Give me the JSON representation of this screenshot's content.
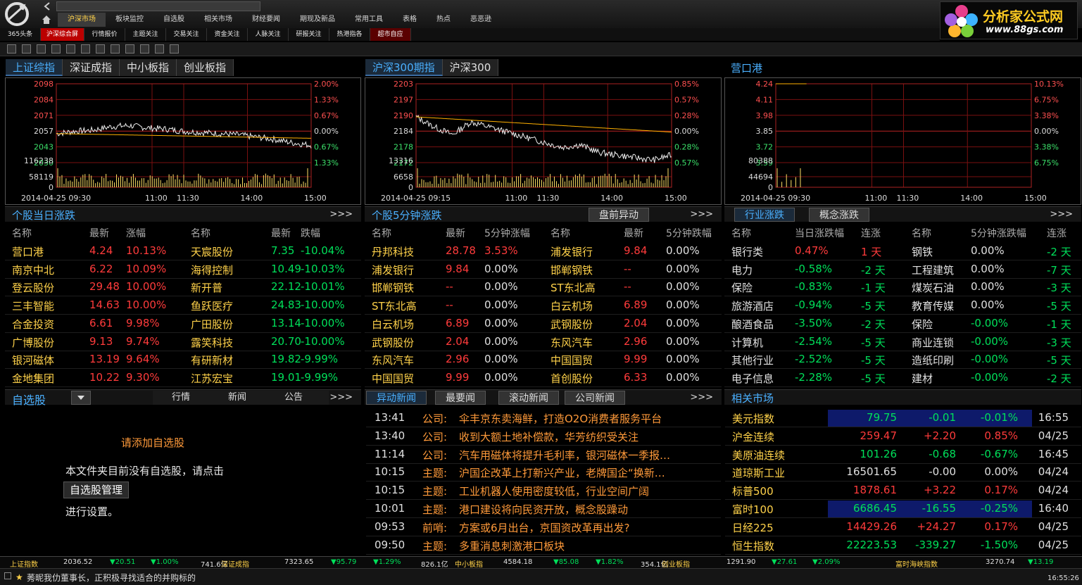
{
  "nav1": [
    "沪深市场",
    "板块监控",
    "自选股",
    "相关市场",
    "财经要闻",
    "期现及新品",
    "常用工具",
    "表格",
    "热点",
    "恶恶逊"
  ],
  "nav2": [
    "365头条",
    "沪深综合屏",
    "行情报价",
    "主题关注",
    "交易关注",
    "资金关注",
    "人脉关注",
    "研报关注",
    "热港指各",
    "超市自应"
  ],
  "brand": {
    "title": "分析家公式网",
    "url": "www.88gs.com"
  },
  "panel1": {
    "tabs": [
      "上证综指",
      "深证成指",
      "中小板指",
      "创业板指"
    ],
    "y_left": [
      "2098",
      "2084",
      "2071",
      "2057",
      "2043",
      "2030"
    ],
    "y_right": [
      "2.00%",
      "1.33%",
      "0.67%",
      "0.00%",
      "0.67%",
      "1.33%"
    ],
    "vol": [
      "116238",
      "58119",
      "0"
    ],
    "date": "2014-04-25 09:30",
    "times": [
      "11:00",
      "11:30",
      "14:00",
      "15:00"
    ]
  },
  "panel2": {
    "tabs": [
      "沪深300期指",
      "沪深300"
    ],
    "y_left": [
      "2203",
      "2197",
      "2190",
      "2184",
      "2178",
      "2172"
    ],
    "y_right": [
      "0.85%",
      "0.57%",
      "0.28%",
      "0.00%",
      "0.28%",
      "0.57%"
    ],
    "vol": [
      "13316",
      "6658",
      "0"
    ],
    "date": "2014-04-25 09:15",
    "times": [
      "11:00",
      "11:30",
      "14:00",
      "15:00"
    ]
  },
  "panel3": {
    "title": "营口港",
    "y_left": [
      "4.24",
      "4.11",
      "3.98",
      "3.85",
      "3.72",
      "3.59"
    ],
    "y_right": [
      "10.13%",
      "6.75%",
      "3.38%",
      "0.00%",
      "3.38%",
      "6.75%"
    ],
    "vol": [
      "80388",
      "44694",
      "0"
    ],
    "date": "2014-04-25 09:30",
    "times": [
      "11:00",
      "11:30",
      "14:00",
      "15:00"
    ]
  },
  "chart_data": [
    {
      "type": "line",
      "title": "上证综指",
      "ylim": [
        2030,
        2098
      ],
      "x": [
        "09:30",
        "11:30/13:00",
        "15:00"
      ],
      "series": [
        {
          "values": [
            2055,
            2057,
            2058,
            2061,
            2062,
            2060,
            2059,
            2057,
            2056,
            2055,
            2054,
            2052,
            2050,
            2047,
            2045
          ]
        }
      ]
    },
    {
      "type": "line",
      "title": "沪深300期指",
      "ylim": [
        2172,
        2203
      ],
      "x": [
        "09:15",
        "11:30/13:00",
        "15:15"
      ],
      "series": [
        {
          "values": [
            2190,
            2186,
            2183,
            2188,
            2186,
            2184,
            2182,
            2180,
            2178,
            2179,
            2176,
            2175,
            2174,
            2173,
            2175
          ]
        }
      ]
    },
    {
      "type": "line",
      "title": "营口港",
      "ylim": [
        3.59,
        4.24
      ],
      "x": [
        "09:30",
        "15:00"
      ],
      "series": [
        {
          "values": [
            4.24,
            4.24,
            4.24,
            4.24,
            4.24,
            4.24,
            4.24,
            4.24
          ]
        }
      ]
    }
  ],
  "sec1": {
    "title": "个股当日涨跌",
    "more": ">>>",
    "hdr": [
      "名称",
      "最新",
      "涨幅",
      "名称",
      "最新",
      "跌幅"
    ],
    "up": [
      [
        "营口港",
        "4.24",
        "10.13%"
      ],
      [
        "南京中北",
        "6.22",
        "10.09%"
      ],
      [
        "登云股份",
        "29.48",
        "10.00%"
      ],
      [
        "三丰智能",
        "14.63",
        "10.00%"
      ],
      [
        "合金投资",
        "6.61",
        "9.98%"
      ],
      [
        "广博股份",
        "9.13",
        "9.74%"
      ],
      [
        "银河磁体",
        "13.19",
        "9.64%"
      ],
      [
        "金地集团",
        "10.22",
        "9.30%"
      ]
    ],
    "down": [
      [
        "天宸股份",
        "7.35",
        "-10.04%"
      ],
      [
        "海得控制",
        "10.49",
        "-10.03%"
      ],
      [
        "新开普",
        "22.12",
        "-10.01%"
      ],
      [
        "鱼跃医疗",
        "24.83",
        "-10.00%"
      ],
      [
        "广田股份",
        "13.14",
        "-10.00%"
      ],
      [
        "露笑科技",
        "20.70",
        "-10.00%"
      ],
      [
        "有研新材",
        "19.82",
        "-9.99%"
      ],
      [
        "江苏宏宝",
        "19.01",
        "-9.99%"
      ]
    ]
  },
  "sec2": {
    "title": "个股5分钟涨跌",
    "btn": "盘前异动",
    "more": ">>>",
    "hdr": [
      "名称",
      "最新",
      "5分钟涨幅",
      "名称",
      "最新",
      "5分钟跌幅"
    ],
    "up": [
      [
        "丹邦科技",
        "28.78",
        "3.53%"
      ],
      [
        "浦发银行",
        "9.84",
        "0.00%"
      ],
      [
        "邯郸钢铁",
        "--",
        "0.00%"
      ],
      [
        "ST东北高",
        "--",
        "0.00%"
      ],
      [
        "白云机场",
        "6.89",
        "0.00%"
      ],
      [
        "武钢股份",
        "2.04",
        "0.00%"
      ],
      [
        "东风汽车",
        "2.96",
        "0.00%"
      ],
      [
        "中国国贸",
        "9.99",
        "0.00%"
      ]
    ],
    "down": [
      [
        "浦发银行",
        "9.84",
        "0.00%"
      ],
      [
        "邯郸钢铁",
        "--",
        "0.00%"
      ],
      [
        "ST东北高",
        "--",
        "0.00%"
      ],
      [
        "白云机场",
        "6.89",
        "0.00%"
      ],
      [
        "武钢股份",
        "2.04",
        "0.00%"
      ],
      [
        "东风汽车",
        "2.96",
        "0.00%"
      ],
      [
        "中国国贸",
        "9.99",
        "0.00%"
      ],
      [
        "首创股份",
        "6.33",
        "0.00%"
      ]
    ]
  },
  "sec3": {
    "tabs": [
      "行业涨跌",
      "概念涨跌"
    ],
    "more": ">>>",
    "hdr": [
      "名称",
      "当日涨跌幅",
      "连涨",
      "名称",
      "5分钟涨跌幅",
      "连涨"
    ],
    "left": [
      [
        "银行类",
        "0.47%",
        "1 天"
      ],
      [
        "电力",
        "-0.58%",
        "-2 天"
      ],
      [
        "保险",
        "-0.83%",
        "-1 天"
      ],
      [
        "旅游酒店",
        "-0.94%",
        "-5 天"
      ],
      [
        "酿酒食品",
        "-3.50%",
        "-2 天"
      ],
      [
        "计算机",
        "-2.54%",
        "-5 天"
      ],
      [
        "其他行业",
        "-2.52%",
        "-5 天"
      ],
      [
        "电子信息",
        "-2.28%",
        "-5 天"
      ]
    ],
    "right": [
      [
        "钢铁",
        "0.00%",
        "-2 天"
      ],
      [
        "工程建筑",
        "0.00%",
        "-7 天"
      ],
      [
        "煤炭石油",
        "0.00%",
        "-3 天"
      ],
      [
        "教育传媒",
        "0.00%",
        "-5 天"
      ],
      [
        "保险",
        "-0.00%",
        "-1 天"
      ],
      [
        "商业连锁",
        "-0.00%",
        "-3 天"
      ],
      [
        "造纸印刷",
        "-0.00%",
        "-5 天"
      ],
      [
        "建材",
        "-0.00%",
        "-2 天"
      ]
    ]
  },
  "sec4": {
    "title": "自选股",
    "tabs": [
      "行情",
      "新闻",
      "公告"
    ],
    "more": ">>>",
    "add_title": "请添加自选股",
    "msg": "本文件夹目前没有自选股，请点击",
    "btn": "自选股管理",
    "msg2": "进行设置。"
  },
  "sec5": {
    "tabs": [
      "异动新闻",
      "最要闻",
      "滚动新闻",
      "公司新闻"
    ],
    "more": ">>>",
    "news": [
      [
        "13:41",
        "公司:",
        "伞丰京东卖海鲜，打造O2O消费者服务平台"
      ],
      [
        "13:40",
        "公司:",
        "收到大额土地补偿款，华芳纺织受关注"
      ],
      [
        "11:14",
        "公司:",
        "汽车用磁体将提升毛利率，银河磁体一季报…"
      ],
      [
        "10:15",
        "主题:",
        "沪国企改革上打新兴产业，老牌国企“换新…"
      ],
      [
        "10:15",
        "主题:",
        "工业机器人使用密度较低，行业空间广阔"
      ],
      [
        "10:01",
        "主题:",
        "港口建设将向民资开放，概念股躁动"
      ],
      [
        "09:53",
        "前哨:",
        "方案或6月出台，京国资改革再出发?"
      ],
      [
        "09:50",
        "主题:",
        "多重消息刺激港口板块"
      ]
    ]
  },
  "sec6": {
    "title": "相关市场",
    "rows": [
      [
        "美元指数",
        "79.75",
        "-0.01",
        "-0.01%",
        "16:55"
      ],
      [
        "沪金连续",
        "259.47",
        "+2.20",
        "0.85%",
        "04/25"
      ],
      [
        "美原油连续",
        "101.26",
        "-0.68",
        "-0.67%",
        "16:45"
      ],
      [
        "道琼斯工业",
        "16501.65",
        "-0.00",
        "0.00%",
        "04/24"
      ],
      [
        "标普500",
        "1878.61",
        "+3.22",
        "0.17%",
        "04/24"
      ],
      [
        "富时100",
        "6686.45",
        "-16.55",
        "-0.25%",
        "16:40"
      ],
      [
        "日经225",
        "14429.26",
        "+24.27",
        "0.17%",
        "04/25"
      ],
      [
        "恒生指数",
        "22223.53",
        "-339.27",
        "-1.50%",
        "04/25"
      ]
    ]
  },
  "status": {
    "items": [
      "上证指数",
      "2036.52",
      "▼20.51",
      "▼1.00%",
      "741.6亿",
      "深证成指",
      "7323.65",
      "▼95.79",
      "▼1.29%",
      "826.1亿",
      "中小板指",
      "4584.18",
      "▼85.08",
      "▼1.82%",
      "354.1亿",
      "创业板指",
      "1291.90",
      "▼27.61",
      "▼2.09%",
      "富时海峡指数",
      "3270.74",
      "▼13.19"
    ],
    "ticker": "莠昵我仂董事长，正积极寻找适合的并购标的",
    "time": "16:55:26"
  },
  "colors": {
    "accent": "#4ab0ff",
    "up": "#ff3b3b",
    "down": "#00e05a",
    "warn": "#ffd24a"
  }
}
